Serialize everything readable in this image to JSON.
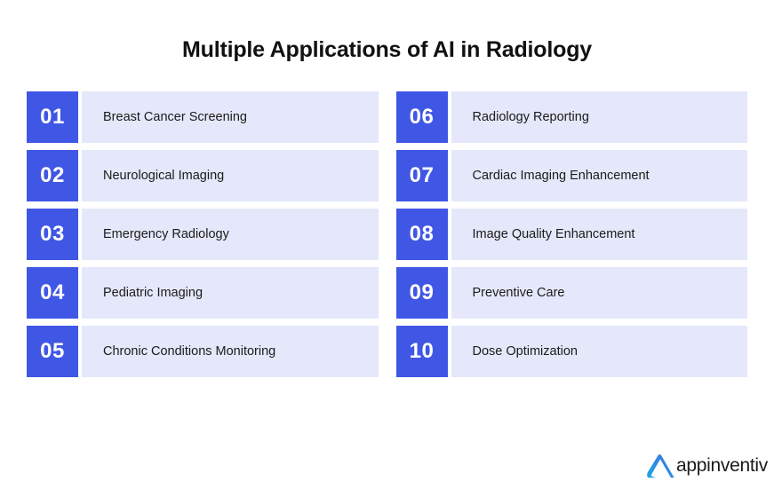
{
  "header": {
    "title": "Multiple Applications of AI in Radiology"
  },
  "colors": {
    "badge_blue": "#4057e5",
    "panel_lavender": "#e4e8fa",
    "background": "#ffffff",
    "text_dark": "#1b1b1b",
    "logo_blue_light": "#27a9e1",
    "logo_blue_dark": "#2f6fe4"
  },
  "list": {
    "left_column": [
      {
        "number": "01",
        "label": "Breast Cancer Screening"
      },
      {
        "number": "02",
        "label": "Neurological Imaging"
      },
      {
        "number": "03",
        "label": "Emergency Radiology"
      },
      {
        "number": "04",
        "label": "Pediatric Imaging"
      },
      {
        "number": "05",
        "label": "Chronic Conditions Monitoring"
      }
    ],
    "right_column": [
      {
        "number": "06",
        "label": "Radiology Reporting"
      },
      {
        "number": "07",
        "label": "Cardiac Imaging Enhancement"
      },
      {
        "number": "08",
        "label": "Image Quality Enhancement"
      },
      {
        "number": "09",
        "label": "Preventive Care"
      },
      {
        "number": "10",
        "label": "Dose Optimization"
      }
    ]
  },
  "footer": {
    "logo_mark_icon": "appinventiv-chevron-a-icon",
    "logo_text": "appinventiv"
  }
}
